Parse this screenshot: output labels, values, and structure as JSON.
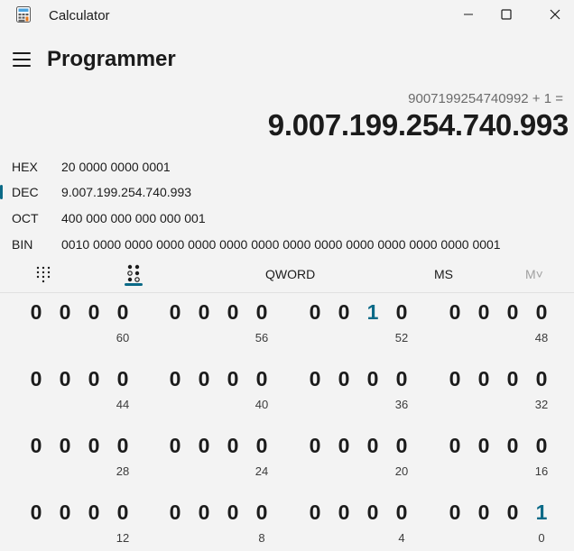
{
  "window": {
    "title": "Calculator",
    "minimize_glyph": "—",
    "maximize_glyph": "☐",
    "close_glyph": "✕"
  },
  "header": {
    "mode_title": "Programmer"
  },
  "display": {
    "expression": "9007199254740992 + 1 =",
    "result": "9.007.199.254.740.993"
  },
  "radix": [
    {
      "label": "HEX",
      "value": "20 0000 0000 0001",
      "selected": false
    },
    {
      "label": "DEC",
      "value": "9.007.199.254.740.993",
      "selected": true
    },
    {
      "label": "OCT",
      "value": "400 000 000 000 000 001",
      "selected": false
    },
    {
      "label": "BIN",
      "value": "0010 0000 0000 0000 0000 0000 0000 0000 0000 0000 0000 0000 0000 0001",
      "selected": false
    }
  ],
  "toolbar": {
    "word_size": "QWORD",
    "memory_store": "MS",
    "memory_list": "M˅",
    "active_keypad": "bit-flip"
  },
  "bits": {
    "rows": [
      {
        "groups": [
          {
            "digits": [
              "0",
              "0",
              "0",
              "0"
            ],
            "position": "60"
          },
          {
            "digits": [
              "0",
              "0",
              "0",
              "0"
            ],
            "position": "56"
          },
          {
            "digits": [
              "0",
              "0",
              "1",
              "0"
            ],
            "position": "52"
          },
          {
            "digits": [
              "0",
              "0",
              "0",
              "0"
            ],
            "position": "48"
          }
        ]
      },
      {
        "groups": [
          {
            "digits": [
              "0",
              "0",
              "0",
              "0"
            ],
            "position": "44"
          },
          {
            "digits": [
              "0",
              "0",
              "0",
              "0"
            ],
            "position": "40"
          },
          {
            "digits": [
              "0",
              "0",
              "0",
              "0"
            ],
            "position": "36"
          },
          {
            "digits": [
              "0",
              "0",
              "0",
              "0"
            ],
            "position": "32"
          }
        ]
      },
      {
        "groups": [
          {
            "digits": [
              "0",
              "0",
              "0",
              "0"
            ],
            "position": "28"
          },
          {
            "digits": [
              "0",
              "0",
              "0",
              "0"
            ],
            "position": "24"
          },
          {
            "digits": [
              "0",
              "0",
              "0",
              "0"
            ],
            "position": "20"
          },
          {
            "digits": [
              "0",
              "0",
              "0",
              "0"
            ],
            "position": "16"
          }
        ]
      },
      {
        "groups": [
          {
            "digits": [
              "0",
              "0",
              "0",
              "0"
            ],
            "position": "12"
          },
          {
            "digits": [
              "0",
              "0",
              "0",
              "0"
            ],
            "position": "8"
          },
          {
            "digits": [
              "0",
              "0",
              "0",
              "0"
            ],
            "position": "4"
          },
          {
            "digits": [
              "0",
              "0",
              "0",
              "1"
            ],
            "position": "0"
          }
        ]
      }
    ]
  },
  "colors": {
    "accent": "#0b6a87",
    "background": "#f3f3f3",
    "text": "#1b1b1b",
    "muted": "#6b6b6b"
  },
  "icons": {
    "app": "calculator-icon",
    "menu": "hamburger-menu-icon",
    "full_keypad": "full-keypad-icon",
    "bit_flip": "bit-flip-icon"
  }
}
